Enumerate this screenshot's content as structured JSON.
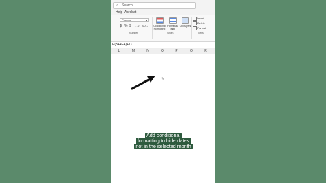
{
  "search": {
    "placeholder": "Search"
  },
  "menu": {
    "help": "Help",
    "acrobat": "Acrobat"
  },
  "ribbon": {
    "number_format_value": "Custom",
    "number_tools": [
      "$",
      "%",
      "9",
      "←.0",
      ".00→"
    ],
    "number_group_label": "Number",
    "conditional_formatting_label": "Conditional Formatting",
    "format_as_table_label": "Format as Table",
    "cell_styles_label": "Cell Styles",
    "styles_group_label": "Styles",
    "insert_label": "Insert",
    "delete_label": "Delete",
    "format_label": "Format",
    "cells_group_label": "Cells"
  },
  "formula_bar": {
    "text": "E(344E4)+1)"
  },
  "columns": [
    "L",
    "M",
    "N",
    "O",
    "P",
    "Q",
    "R"
  ],
  "caption": {
    "line1": "Add conditional",
    "line2": "formatting to hide dates",
    "line3": "not in the selected month"
  },
  "colors": {
    "background": "#5b8a6b",
    "caption_bg": "#2e5a3e"
  }
}
